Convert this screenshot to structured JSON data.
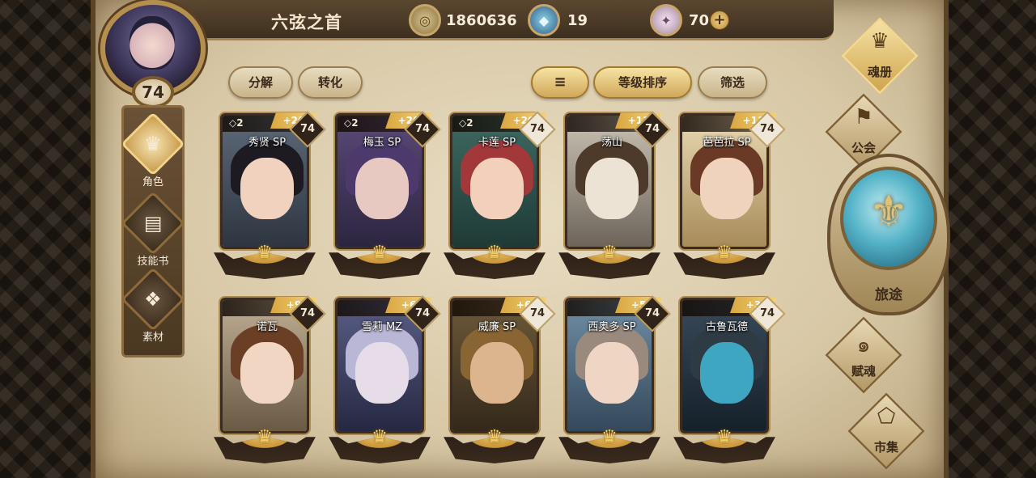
{
  "header": {
    "title": "六弦之首",
    "currencies": [
      {
        "icon": "coin-icon",
        "value": "1860636"
      },
      {
        "icon": "blue-crystal-icon",
        "value": "19"
      },
      {
        "icon": "pink-gem-icon",
        "value": "70"
      }
    ],
    "plus_label": "+"
  },
  "player": {
    "level": "74"
  },
  "left_nav": [
    {
      "label": "角色",
      "icon": "character-icon",
      "active": true
    },
    {
      "label": "技能书",
      "icon": "skill-book-icon",
      "active": false
    },
    {
      "label": "素材",
      "icon": "material-icon",
      "active": false
    }
  ],
  "toolbar": {
    "decompose_label": "分解",
    "convert_label": "转化",
    "sort_order_icon": "sort-lines-icon",
    "sort_label": "等级排序",
    "filter_label": "筛选"
  },
  "cards": [
    {
      "name": "秀贤 SP",
      "stars": "◇2",
      "plus": "+20",
      "level": "74",
      "level_style": "dark"
    },
    {
      "name": "梅玉 SP",
      "stars": "◇2",
      "plus": "+20",
      "level": "74",
      "level_style": "dark"
    },
    {
      "name": "卡莲 SP",
      "stars": "◇2",
      "plus": "+20",
      "level": "74",
      "level_style": "light"
    },
    {
      "name": "荡山",
      "stars": "",
      "plus": "+11",
      "level": "74",
      "level_style": "dark"
    },
    {
      "name": "芭芭拉 SP",
      "stars": "",
      "plus": "+11",
      "level": "74",
      "level_style": "light"
    },
    {
      "name": "诺瓦",
      "stars": "",
      "plus": "+9",
      "level": "74",
      "level_style": "dark"
    },
    {
      "name": "雪莉 MZ",
      "stars": "",
      "plus": "+6",
      "level": "74",
      "level_style": "dark"
    },
    {
      "name": "威廉 SP",
      "stars": "",
      "plus": "+6",
      "level": "74",
      "level_style": "light"
    },
    {
      "name": "西奥多 SP",
      "stars": "",
      "plus": "+5",
      "level": "74",
      "level_style": "dark"
    },
    {
      "name": "古鲁瓦德",
      "stars": "",
      "plus": "+3",
      "level": "74",
      "level_style": "light"
    }
  ],
  "right_nav": {
    "soul_book": "魂册",
    "guild": "公会",
    "journey": "旅途",
    "endow_soul": "赋魂",
    "market": "市集"
  },
  "colors": {
    "accent_gold": "#d9a741",
    "parchment": "#e8dcc2",
    "dark_frame": "#3a2c20"
  }
}
